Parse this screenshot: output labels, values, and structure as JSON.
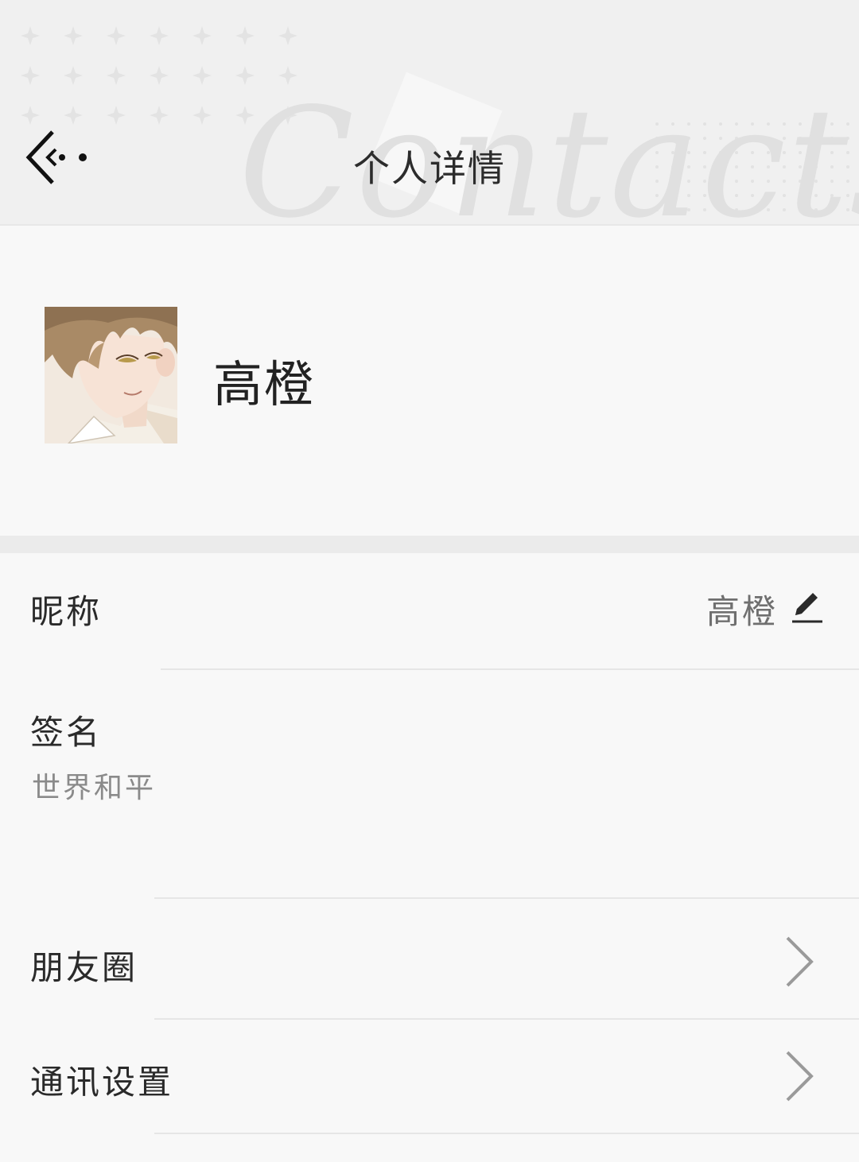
{
  "header": {
    "title": "个人详情",
    "watermark": "Contacts",
    "back_icon": "back-arrow-icon"
  },
  "profile": {
    "name": "高橙",
    "avatar": "anime-character-avatar"
  },
  "fields": {
    "nickname_label": "昵称",
    "nickname_value": "高橙",
    "edit_icon": "pencil-icon",
    "signature_label": "签名",
    "signature_value": "世界和平"
  },
  "links": [
    {
      "label": "朋友圈",
      "icon": "chevron-right-icon"
    },
    {
      "label": "通讯设置",
      "icon": "chevron-right-icon"
    }
  ],
  "colors": {
    "header_bg": "#f0f0f0",
    "page_bg": "#f8f8f8",
    "separator": "#ebebeb",
    "text_primary": "#2a2a2a",
    "text_secondary": "#8a8a8a"
  }
}
